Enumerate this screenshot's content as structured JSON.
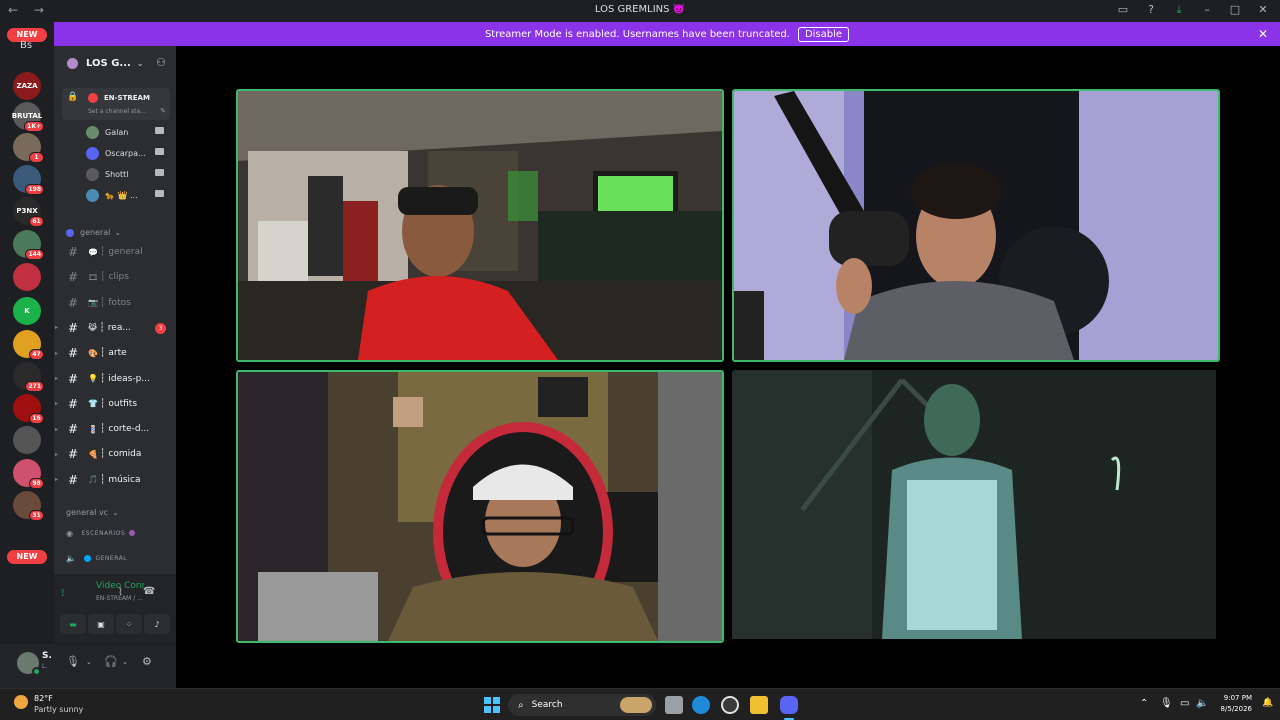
{
  "window": {
    "title": "LOS GREMLINS 👿",
    "nav": "← →"
  },
  "banner": {
    "message": "Streamer Mode is enabled. Usernames have been truncated.",
    "disable_label": "Disable",
    "close": "✕"
  },
  "rail": {
    "new_top": "NEW",
    "top_abbr": "Bs",
    "new_bottom": "NEW",
    "servers": [
      {
        "label": "ZAZA",
        "color": "#8b1a1a",
        "badge": ""
      },
      {
        "label": "BRUTAL",
        "color": "#5a5a5a",
        "badge": "1K+"
      },
      {
        "label": "",
        "color": "#7a6a5a",
        "badge": "1"
      },
      {
        "label": "",
        "color": "#3a5a7a",
        "badge": "198"
      },
      {
        "label": "P3NX",
        "color": "#2a2a2a",
        "badge": "61"
      },
      {
        "label": "",
        "color": "#4a7a5a",
        "badge": "144"
      },
      {
        "label": "",
        "color": "#c03040",
        "badge": ""
      },
      {
        "label": "K",
        "color": "#1bb24a",
        "badge": ""
      },
      {
        "label": "",
        "color": "#e0a020",
        "badge": "47"
      },
      {
        "label": "",
        "color": "#2a2a2a",
        "badge": "271"
      },
      {
        "label": "",
        "color": "#a01010",
        "badge": "16"
      },
      {
        "label": "",
        "color": "#555555",
        "badge": ""
      },
      {
        "label": "",
        "color": "#d05070",
        "badge": "98"
      },
      {
        "label": "",
        "color": "#6a4a3a",
        "badge": "31"
      }
    ]
  },
  "guild": {
    "name": "LOS G...",
    "voice_channel": "EN-STREAM",
    "voice_status": "Set a channel sta...",
    "members": [
      {
        "name": "Galan",
        "color": "#6a8a6a"
      },
      {
        "name": "Oscarpa...",
        "color": "#5865f2"
      },
      {
        "name": "Shottl",
        "color": "#5a5a5a"
      },
      {
        "name": "🐆 👑 ...",
        "color": "#4a8ab0"
      }
    ],
    "category_text": "general",
    "channels": [
      {
        "name": "general",
        "emoji": "💬",
        "unread": false,
        "mention": ""
      },
      {
        "name": "clips",
        "emoji": "🎞",
        "unread": false,
        "mention": ""
      },
      {
        "name": "fotos",
        "emoji": "📷",
        "unread": false,
        "mention": ""
      },
      {
        "name": "rea...",
        "emoji": "😹",
        "unread": true,
        "mention": "3"
      },
      {
        "name": "arte",
        "emoji": "🎨",
        "unread": true,
        "mention": ""
      },
      {
        "name": "ideas-p...",
        "emoji": "💡",
        "unread": true,
        "mention": ""
      },
      {
        "name": "outfits",
        "emoji": "👕",
        "unread": true,
        "mention": ""
      },
      {
        "name": "corte-d...",
        "emoji": "💈",
        "unread": true,
        "mention": ""
      },
      {
        "name": "comida",
        "emoji": "🍕",
        "unread": true,
        "mention": ""
      },
      {
        "name": "música",
        "emoji": "🎵",
        "unread": true,
        "mention": ""
      }
    ],
    "category_voice": "general vc",
    "voice_channels": [
      {
        "name": "ESCENARIOS",
        "icon": "stage-icon"
      },
      {
        "name": "GENERAL",
        "icon": "speaker-icon"
      }
    ]
  },
  "voice_panel": {
    "title": "Video Connec",
    "subtitle": "EN-STREAM / ..."
  },
  "user": {
    "name": "S.",
    "tag": "L."
  },
  "taskbar": {
    "temp": "82°F",
    "weather": "Partly sunny",
    "search": "Search",
    "time": "9:07 PM",
    "date": "8/5/2026"
  },
  "colors": {
    "blurple": "#5865f2",
    "streamer_banner": "#8a33e8",
    "speaking": "#3dbb6a",
    "danger": "#f23f43"
  }
}
